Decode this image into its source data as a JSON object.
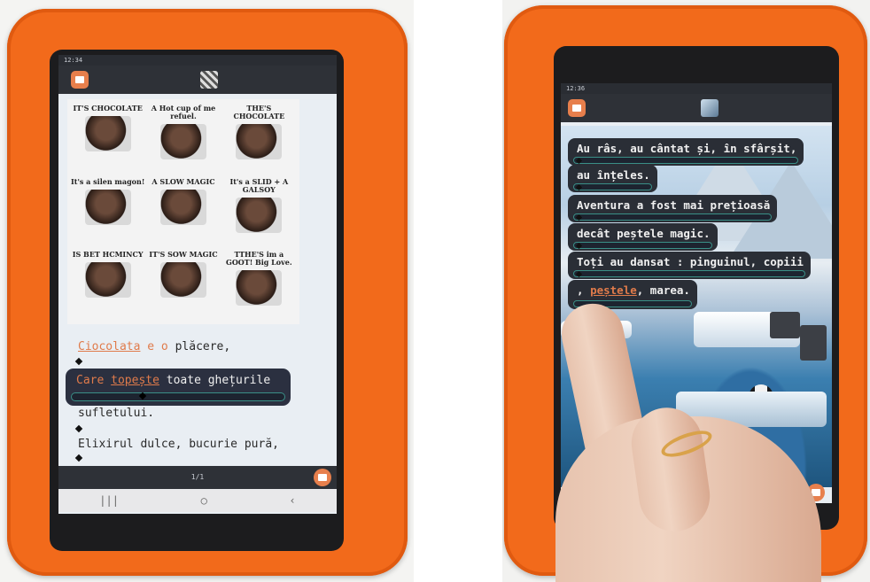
{
  "left_tablet": {
    "status_time": "12:34",
    "image_panel_captions": [
      "IT'S CHOCOLATE",
      "A Hot cup of me refuel.",
      "THE'S CHOCOLATE",
      "It's a silen magon!",
      "A SLOW MAGIC",
      "It's a SLID + A GALSOY",
      "IS BET HCMINCY",
      "IT'S SOW MAGIC",
      "TTHE'S im a GOOT! Big Love."
    ],
    "poem_lines": {
      "line1_word1": "Ciocolata",
      "line1_word2": "e o",
      "line1_rest": "plăcere,",
      "line2_word1": "Care",
      "line2_word2": "topește",
      "line2_rest": "toate ghețurile",
      "line3": "sufletului.",
      "line4": "Elixirul dulce, bucurie pură,"
    },
    "page_indicator": "1/1",
    "nav_buttons": [
      "|||",
      "○",
      "‹"
    ]
  },
  "right_tablet": {
    "status_time": "12:36",
    "chips": [
      "Au râs, au cântat și, în sfârșit,",
      "au înțeles.",
      "Aventura a fost mai prețioasă",
      "decât peștele magic.",
      "Toți au dansat : pinguinul, copiii"
    ],
    "last_chip": {
      "prefix": ", ",
      "highlight": "peștele",
      "suffix": ", marea."
    }
  },
  "colors": {
    "case_orange": "#f26a1b",
    "highlight_orange": "#e07b4b",
    "chip_background": "#2a2e36",
    "progress_teal": "#3a8f87"
  }
}
